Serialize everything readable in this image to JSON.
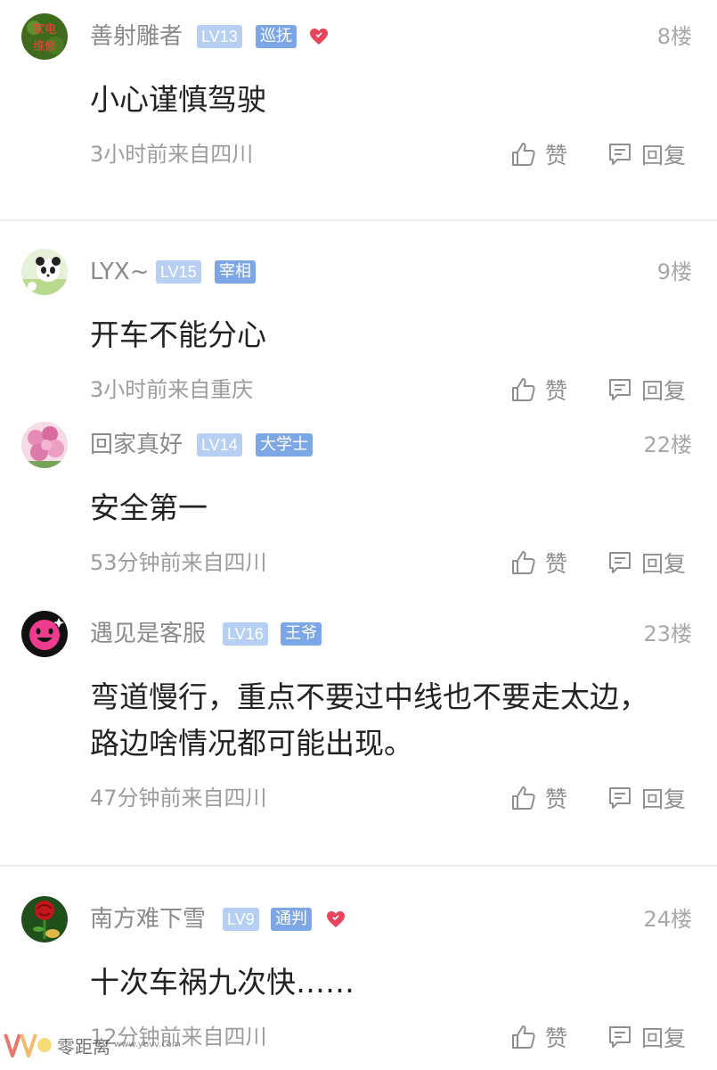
{
  "comments": [
    {
      "username": "善射雕者",
      "level": "LV13",
      "title": "巡抚",
      "floor": "8楼",
      "text": "小心谨慎驾驶",
      "meta": "3小时前来自四川",
      "like_label": "赞",
      "reply_label": "回复",
      "avatar_text": "家电维修"
    },
    {
      "username": "LYX~",
      "level": "LV15",
      "title": "宰相",
      "floor": "9楼",
      "text": "开车不能分心",
      "meta": "3小时前来自重庆",
      "like_label": "赞",
      "reply_label": "回复"
    },
    {
      "username": "回家真好",
      "level": "LV14",
      "title": "大学士",
      "floor": "22楼",
      "text": "安全第一",
      "meta": "53分钟前来自四川",
      "like_label": "赞",
      "reply_label": "回复"
    },
    {
      "username": "遇见是客服",
      "level": "LV16",
      "title": "王爷",
      "floor": "23楼",
      "text": "弯道慢行，重点不要过中线也不要走太边，路边啥情况都可能出现。",
      "meta": "47分钟前来自四川",
      "like_label": "赞",
      "reply_label": "回复"
    },
    {
      "username": "南方难下雪",
      "level": "LV9",
      "title": "通判",
      "floor": "24楼",
      "text": "十次车祸九次快……",
      "meta": "12分钟前来自四川",
      "like_label": "赞",
      "reply_label": "回复"
    }
  ],
  "watermark": {
    "name": "零距离",
    "url": "www.ybvv.com"
  },
  "colors": {
    "lv_badge": "#b6cff2",
    "title_badge": "#7da6e6",
    "heart": "#e8455b",
    "divider": "#eeeeee"
  },
  "icons": {
    "like": "thumbs-up-icon",
    "reply": "comment-bubble-icon",
    "vip": "heart-icon"
  }
}
